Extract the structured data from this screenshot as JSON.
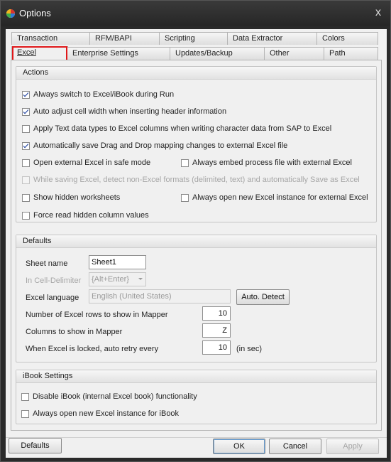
{
  "window": {
    "title": "Options",
    "close_label": "x"
  },
  "tabs_row1": [
    "Transaction",
    "RFM/BAPI",
    "Scripting",
    "Data Extractor",
    "Colors"
  ],
  "tabs_row2": [
    "Excel",
    "Enterprise Settings",
    "Updates/Backup",
    "Other",
    "Path"
  ],
  "actions": {
    "title": "Actions",
    "items": [
      {
        "label": "Always switch to Excel/iBook during Run",
        "checked": true
      },
      {
        "label": "Auto adjust cell width when inserting header information",
        "checked": true
      },
      {
        "label": "Apply Text data types to Excel columns when writing character data from SAP to Excel",
        "checked": false
      },
      {
        "label": "Automatically save Drag and Drop mapping changes to external Excel file",
        "checked": true
      },
      {
        "label": "Open external Excel in safe mode",
        "checked": false
      },
      {
        "label": "Always embed process file with external Excel",
        "checked": false
      },
      {
        "label": "While saving Excel, detect non-Excel formats (delimited, text) and automatically Save as Excel",
        "checked": false,
        "disabled": true
      },
      {
        "label": "Show hidden worksheets",
        "checked": false
      },
      {
        "label": "Always open new Excel instance for external Excel",
        "checked": false
      },
      {
        "label": "Force read hidden column values",
        "checked": false
      }
    ]
  },
  "defaults": {
    "title": "Defaults",
    "sheet_name_label": "Sheet name",
    "sheet_name_value": "Sheet1",
    "delimiter_label": "In Cell-Delimiter",
    "delimiter_value": "{Alt+Enter}",
    "language_label": "Excel language",
    "language_value": "English (United States)",
    "auto_detect_label": "Auto. Detect",
    "rows_label": "Number of Excel rows to show in Mapper",
    "rows_value": "10",
    "columns_label": "Columns to show in Mapper",
    "columns_value": "Z",
    "retry_label": "When Excel is locked, auto retry every",
    "retry_value": "10",
    "retry_unit": "(in sec)"
  },
  "ibook": {
    "title": "iBook Settings",
    "items": [
      {
        "label": "Disable iBook (internal Excel book) functionality",
        "checked": false
      },
      {
        "label": "Always open new Excel instance for iBook",
        "checked": false
      }
    ]
  },
  "buttons": {
    "defaults": "Defaults",
    "ok": "OK",
    "cancel": "Cancel",
    "apply": "Apply"
  }
}
